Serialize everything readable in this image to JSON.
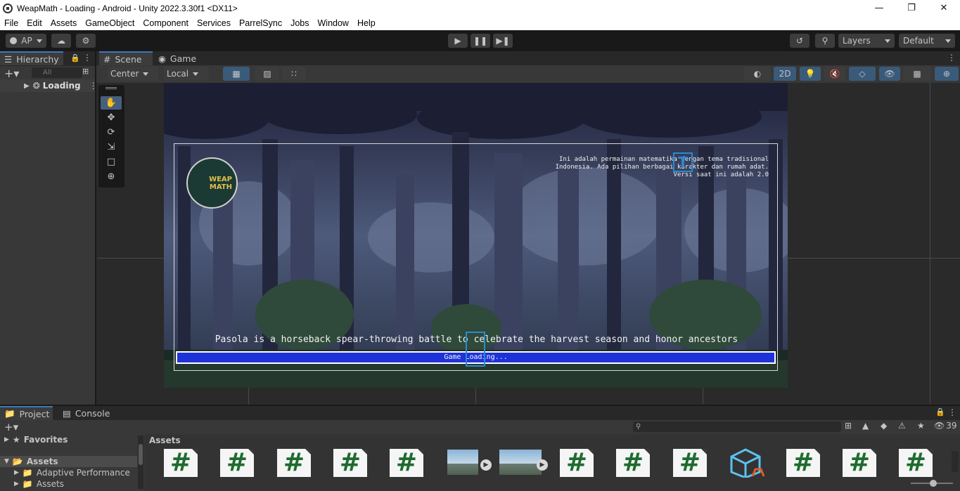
{
  "window": {
    "title": "WeapMath - Loading - Android - Unity 2022.3.30f1 <DX11>"
  },
  "menu": [
    "File",
    "Edit",
    "Assets",
    "GameObject",
    "Component",
    "Services",
    "ParrelSync",
    "Jobs",
    "Window",
    "Help"
  ],
  "toolbar": {
    "account": "AP",
    "layers": "Layers",
    "layout": "Default"
  },
  "hierarchy": {
    "tab": "Hierarchy",
    "search_placeholder": "All",
    "scene_item": "Loading"
  },
  "scene_tabs": {
    "scene": "Scene",
    "game": "Game"
  },
  "scene_toolbar": {
    "pivot": "Center",
    "space": "Local",
    "mode_2d": "2D"
  },
  "game": {
    "logo_line1": "WEAP",
    "logo_line2": "MATH",
    "info_line1": "Ini adalah permainan matematika dengan tema tradisional",
    "info_line2": "Indonesia. Ada pilihan berbagai karakter dan rumah adat.",
    "info_line3": "Versi saat ini adalah 2.0",
    "caption": "Pasola is a horseback spear-throwing battle to celebrate the harvest season and honor ancestors",
    "loading_label": "Game Loading...",
    "loading_progress": 1.0
  },
  "bottom_tabs": {
    "project": "Project",
    "console": "Console"
  },
  "project": {
    "favorites": "Favorites",
    "assets_root": "Assets",
    "folders": [
      "Adaptive Performance",
      "Assets"
    ],
    "breadcrumb": "Assets",
    "count": "39",
    "tiles": [
      "#",
      "#",
      "#",
      "#",
      "#",
      "img",
      "img",
      "#",
      "#",
      "#",
      "prefab",
      "#",
      "#",
      "#"
    ]
  },
  "colors": {
    "accent": "#3a79bb",
    "loading_bar": "#1e32d8",
    "scene_bg": "#191919",
    "panel": "#383838"
  }
}
